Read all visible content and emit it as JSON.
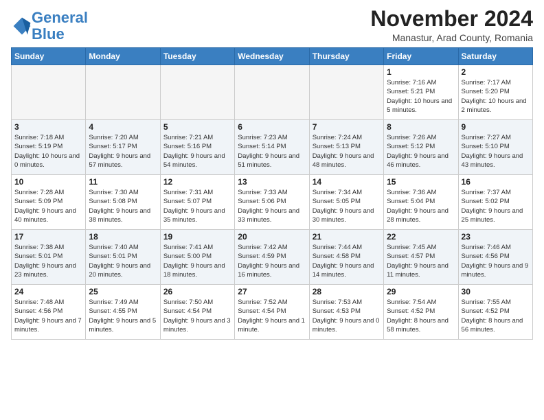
{
  "logo": {
    "line1": "General",
    "line2": "Blue"
  },
  "header": {
    "month": "November 2024",
    "location": "Manastur, Arad County, Romania"
  },
  "weekdays": [
    "Sunday",
    "Monday",
    "Tuesday",
    "Wednesday",
    "Thursday",
    "Friday",
    "Saturday"
  ],
  "weeks": [
    [
      {
        "day": "",
        "empty": true
      },
      {
        "day": "",
        "empty": true
      },
      {
        "day": "",
        "empty": true
      },
      {
        "day": "",
        "empty": true
      },
      {
        "day": "",
        "empty": true
      },
      {
        "day": "1",
        "info": "Sunrise: 7:16 AM\nSunset: 5:21 PM\nDaylight: 10 hours\nand 5 minutes."
      },
      {
        "day": "2",
        "info": "Sunrise: 7:17 AM\nSunset: 5:20 PM\nDaylight: 10 hours\nand 2 minutes."
      }
    ],
    [
      {
        "day": "3",
        "info": "Sunrise: 7:18 AM\nSunset: 5:19 PM\nDaylight: 10 hours\nand 0 minutes."
      },
      {
        "day": "4",
        "info": "Sunrise: 7:20 AM\nSunset: 5:17 PM\nDaylight: 9 hours\nand 57 minutes."
      },
      {
        "day": "5",
        "info": "Sunrise: 7:21 AM\nSunset: 5:16 PM\nDaylight: 9 hours\nand 54 minutes."
      },
      {
        "day": "6",
        "info": "Sunrise: 7:23 AM\nSunset: 5:14 PM\nDaylight: 9 hours\nand 51 minutes."
      },
      {
        "day": "7",
        "info": "Sunrise: 7:24 AM\nSunset: 5:13 PM\nDaylight: 9 hours\nand 48 minutes."
      },
      {
        "day": "8",
        "info": "Sunrise: 7:26 AM\nSunset: 5:12 PM\nDaylight: 9 hours\nand 46 minutes."
      },
      {
        "day": "9",
        "info": "Sunrise: 7:27 AM\nSunset: 5:10 PM\nDaylight: 9 hours\nand 43 minutes."
      }
    ],
    [
      {
        "day": "10",
        "info": "Sunrise: 7:28 AM\nSunset: 5:09 PM\nDaylight: 9 hours\nand 40 minutes."
      },
      {
        "day": "11",
        "info": "Sunrise: 7:30 AM\nSunset: 5:08 PM\nDaylight: 9 hours\nand 38 minutes."
      },
      {
        "day": "12",
        "info": "Sunrise: 7:31 AM\nSunset: 5:07 PM\nDaylight: 9 hours\nand 35 minutes."
      },
      {
        "day": "13",
        "info": "Sunrise: 7:33 AM\nSunset: 5:06 PM\nDaylight: 9 hours\nand 33 minutes."
      },
      {
        "day": "14",
        "info": "Sunrise: 7:34 AM\nSunset: 5:05 PM\nDaylight: 9 hours\nand 30 minutes."
      },
      {
        "day": "15",
        "info": "Sunrise: 7:36 AM\nSunset: 5:04 PM\nDaylight: 9 hours\nand 28 minutes."
      },
      {
        "day": "16",
        "info": "Sunrise: 7:37 AM\nSunset: 5:02 PM\nDaylight: 9 hours\nand 25 minutes."
      }
    ],
    [
      {
        "day": "17",
        "info": "Sunrise: 7:38 AM\nSunset: 5:01 PM\nDaylight: 9 hours\nand 23 minutes."
      },
      {
        "day": "18",
        "info": "Sunrise: 7:40 AM\nSunset: 5:01 PM\nDaylight: 9 hours\nand 20 minutes."
      },
      {
        "day": "19",
        "info": "Sunrise: 7:41 AM\nSunset: 5:00 PM\nDaylight: 9 hours\nand 18 minutes."
      },
      {
        "day": "20",
        "info": "Sunrise: 7:42 AM\nSunset: 4:59 PM\nDaylight: 9 hours\nand 16 minutes."
      },
      {
        "day": "21",
        "info": "Sunrise: 7:44 AM\nSunset: 4:58 PM\nDaylight: 9 hours\nand 14 minutes."
      },
      {
        "day": "22",
        "info": "Sunrise: 7:45 AM\nSunset: 4:57 PM\nDaylight: 9 hours\nand 11 minutes."
      },
      {
        "day": "23",
        "info": "Sunrise: 7:46 AM\nSunset: 4:56 PM\nDaylight: 9 hours\nand 9 minutes."
      }
    ],
    [
      {
        "day": "24",
        "info": "Sunrise: 7:48 AM\nSunset: 4:56 PM\nDaylight: 9 hours\nand 7 minutes."
      },
      {
        "day": "25",
        "info": "Sunrise: 7:49 AM\nSunset: 4:55 PM\nDaylight: 9 hours\nand 5 minutes."
      },
      {
        "day": "26",
        "info": "Sunrise: 7:50 AM\nSunset: 4:54 PM\nDaylight: 9 hours\nand 3 minutes."
      },
      {
        "day": "27",
        "info": "Sunrise: 7:52 AM\nSunset: 4:54 PM\nDaylight: 9 hours\nand 1 minute."
      },
      {
        "day": "28",
        "info": "Sunrise: 7:53 AM\nSunset: 4:53 PM\nDaylight: 9 hours\nand 0 minutes."
      },
      {
        "day": "29",
        "info": "Sunrise: 7:54 AM\nSunset: 4:52 PM\nDaylight: 8 hours\nand 58 minutes."
      },
      {
        "day": "30",
        "info": "Sunrise: 7:55 AM\nSunset: 4:52 PM\nDaylight: 8 hours\nand 56 minutes."
      }
    ]
  ]
}
